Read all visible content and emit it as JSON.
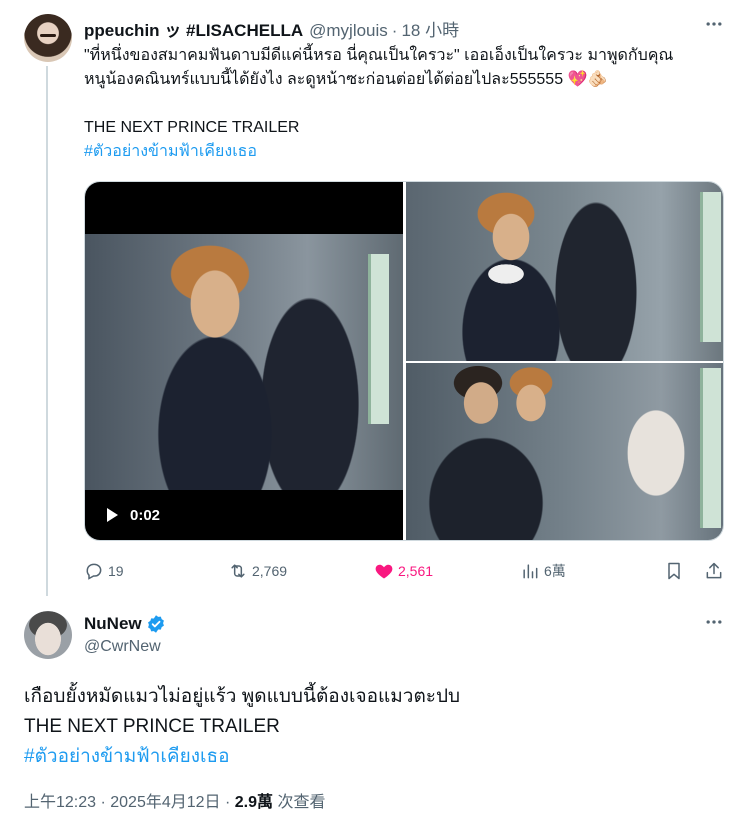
{
  "reply_tweet": {
    "display_name": "ppeuchin ッ #LISACHELLA",
    "handle": "@myjlouis",
    "separator": "·",
    "time": "18 小時",
    "text_line1": "\"ที่หนึ่งของสมาคมฟันดาบมีดีแค่นี้หรอ นี่คุณเป็นใครวะ\" เออเอ็งเป็นใครวะ มาพูดกับคุณ",
    "text_line2": "หนูน้องคณินทร์แบบนี้ได้ยังไง ละดูหน้าซะก่อนต่อยได้ต่อยไปละ555555",
    "text_emojis": "💖🫵🏻",
    "text_line3": "THE NEXT PRINCE TRAILER",
    "hashtag": "#ตัวอย่างข้ามฟ้าเคียงเธอ",
    "video_time": "0:02",
    "replies": "19",
    "retweets": "2,769",
    "likes": "2,561",
    "views": "6萬"
  },
  "main_tweet": {
    "display_name": "NuNew",
    "handle": "@CwrNew",
    "text_line1": "เกือบยั้งหมัดแมวไม่อยู่แร้ว พูดแบบนี้ต้องเจอแมวตะปบ",
    "text_line2": "THE NEXT PRINCE TRAILER",
    "hashtag": "#ตัวอย่างข้ามฟ้าเคียงเธอ",
    "timestamp": "上午12:23 · 2025年4月12日 · ",
    "views_count": "2.9萬",
    "views_label": " 次查看"
  },
  "icons": {
    "more": "more-horizontal-icon",
    "reply": "reply-bubble-icon",
    "retweet": "retweet-arrows-icon",
    "like": "heart-icon",
    "views": "bar-chart-icon",
    "bookmark": "bookmark-icon",
    "share": "share-upload-icon",
    "verified": "verified-badge-icon",
    "play": "play-icon"
  },
  "colors": {
    "link": "#1d9bf0",
    "like_active": "#f91880",
    "muted": "#536471",
    "verified": "#1d9bf0"
  }
}
